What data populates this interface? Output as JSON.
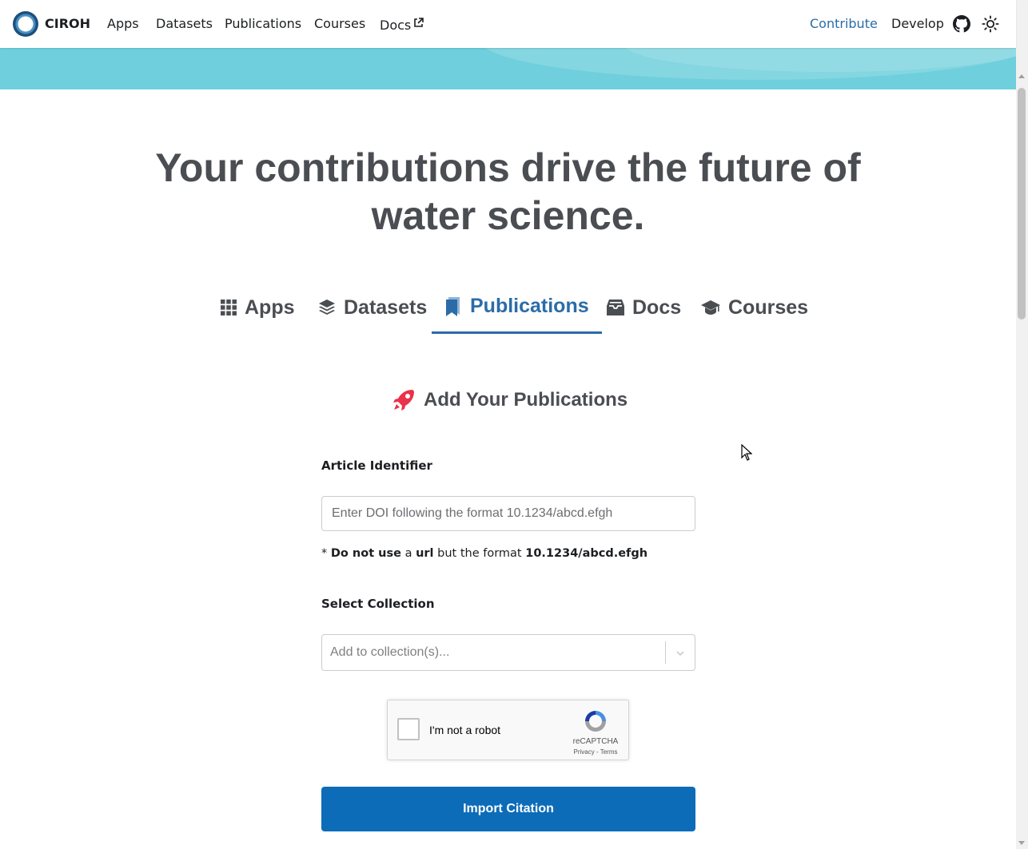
{
  "navbar": {
    "brand": "CIROH",
    "items": [
      "Apps",
      "Datasets",
      "Publications",
      "Courses",
      "Docs"
    ],
    "right_items": [
      "Contribute",
      "Develop"
    ],
    "active_color": "#2b6ca8"
  },
  "hero": {
    "headline": "Your contributions drive the future of water science."
  },
  "tabs": {
    "items": [
      "Apps",
      "Datasets",
      "Publications",
      "Docs",
      "Courses"
    ],
    "active": "Publications"
  },
  "form": {
    "title": "Add Your Publications",
    "identifier_label": "Article Identifier",
    "doi_placeholder": "Enter DOI following the format 10.1234/abcd.efgh",
    "hint": {
      "prefix": "* ",
      "bold1": "Do not use",
      "mid1": " a ",
      "bold2": "url",
      "mid2": " but the format ",
      "bold3": "10.1234/abcd.efgh"
    },
    "collection_label": "Select Collection",
    "collection_placeholder": "Add to collection(s)...",
    "captcha": {
      "label": "I'm not a robot",
      "brand": "reCAPTCHA",
      "links": "Privacy - Terms"
    },
    "submit_label": "Import Citation",
    "submit_color": "#0c6cb8"
  },
  "icons": {
    "external-link": "external-link-icon",
    "github": "github-icon",
    "theme": "sun-icon",
    "apps": "grid-icon",
    "datasets": "layers-icon",
    "publications": "bookmark-icon",
    "docs": "inbox-icon",
    "courses": "graduation-cap-icon",
    "title": "rocket-icon"
  }
}
